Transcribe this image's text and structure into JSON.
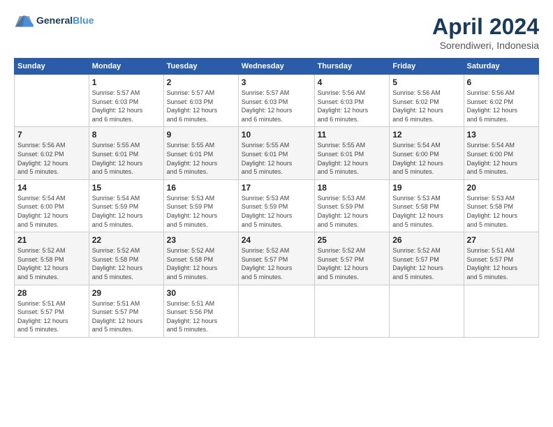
{
  "logo": {
    "text_general": "General",
    "text_blue": "Blue"
  },
  "title": "April 2024",
  "location": "Sorendiweri, Indonesia",
  "days_of_week": [
    "Sunday",
    "Monday",
    "Tuesday",
    "Wednesday",
    "Thursday",
    "Friday",
    "Saturday"
  ],
  "weeks": [
    [
      {
        "day": "",
        "info": ""
      },
      {
        "day": "1",
        "info": "Sunrise: 5:57 AM\nSunset: 6:03 PM\nDaylight: 12 hours\nand 6 minutes."
      },
      {
        "day": "2",
        "info": "Sunrise: 5:57 AM\nSunset: 6:03 PM\nDaylight: 12 hours\nand 6 minutes."
      },
      {
        "day": "3",
        "info": "Sunrise: 5:57 AM\nSunset: 6:03 PM\nDaylight: 12 hours\nand 6 minutes."
      },
      {
        "day": "4",
        "info": "Sunrise: 5:56 AM\nSunset: 6:03 PM\nDaylight: 12 hours\nand 6 minutes."
      },
      {
        "day": "5",
        "info": "Sunrise: 5:56 AM\nSunset: 6:02 PM\nDaylight: 12 hours\nand 6 minutes."
      },
      {
        "day": "6",
        "info": "Sunrise: 5:56 AM\nSunset: 6:02 PM\nDaylight: 12 hours\nand 6 minutes."
      }
    ],
    [
      {
        "day": "7",
        "info": "Sunrise: 5:56 AM\nSunset: 6:02 PM\nDaylight: 12 hours\nand 5 minutes."
      },
      {
        "day": "8",
        "info": "Sunrise: 5:55 AM\nSunset: 6:01 PM\nDaylight: 12 hours\nand 5 minutes."
      },
      {
        "day": "9",
        "info": "Sunrise: 5:55 AM\nSunset: 6:01 PM\nDaylight: 12 hours\nand 5 minutes."
      },
      {
        "day": "10",
        "info": "Sunrise: 5:55 AM\nSunset: 6:01 PM\nDaylight: 12 hours\nand 5 minutes."
      },
      {
        "day": "11",
        "info": "Sunrise: 5:55 AM\nSunset: 6:01 PM\nDaylight: 12 hours\nand 5 minutes."
      },
      {
        "day": "12",
        "info": "Sunrise: 5:54 AM\nSunset: 6:00 PM\nDaylight: 12 hours\nand 5 minutes."
      },
      {
        "day": "13",
        "info": "Sunrise: 5:54 AM\nSunset: 6:00 PM\nDaylight: 12 hours\nand 5 minutes."
      }
    ],
    [
      {
        "day": "14",
        "info": "Sunrise: 5:54 AM\nSunset: 6:00 PM\nDaylight: 12 hours\nand 5 minutes."
      },
      {
        "day": "15",
        "info": "Sunrise: 5:54 AM\nSunset: 5:59 PM\nDaylight: 12 hours\nand 5 minutes."
      },
      {
        "day": "16",
        "info": "Sunrise: 5:53 AM\nSunset: 5:59 PM\nDaylight: 12 hours\nand 5 minutes."
      },
      {
        "day": "17",
        "info": "Sunrise: 5:53 AM\nSunset: 5:59 PM\nDaylight: 12 hours\nand 5 minutes."
      },
      {
        "day": "18",
        "info": "Sunrise: 5:53 AM\nSunset: 5:59 PM\nDaylight: 12 hours\nand 5 minutes."
      },
      {
        "day": "19",
        "info": "Sunrise: 5:53 AM\nSunset: 5:58 PM\nDaylight: 12 hours\nand 5 minutes."
      },
      {
        "day": "20",
        "info": "Sunrise: 5:53 AM\nSunset: 5:58 PM\nDaylight: 12 hours\nand 5 minutes."
      }
    ],
    [
      {
        "day": "21",
        "info": "Sunrise: 5:52 AM\nSunset: 5:58 PM\nDaylight: 12 hours\nand 5 minutes."
      },
      {
        "day": "22",
        "info": "Sunrise: 5:52 AM\nSunset: 5:58 PM\nDaylight: 12 hours\nand 5 minutes."
      },
      {
        "day": "23",
        "info": "Sunrise: 5:52 AM\nSunset: 5:58 PM\nDaylight: 12 hours\nand 5 minutes."
      },
      {
        "day": "24",
        "info": "Sunrise: 5:52 AM\nSunset: 5:57 PM\nDaylight: 12 hours\nand 5 minutes."
      },
      {
        "day": "25",
        "info": "Sunrise: 5:52 AM\nSunset: 5:57 PM\nDaylight: 12 hours\nand 5 minutes."
      },
      {
        "day": "26",
        "info": "Sunrise: 5:52 AM\nSunset: 5:57 PM\nDaylight: 12 hours\nand 5 minutes."
      },
      {
        "day": "27",
        "info": "Sunrise: 5:51 AM\nSunset: 5:57 PM\nDaylight: 12 hours\nand 5 minutes."
      }
    ],
    [
      {
        "day": "28",
        "info": "Sunrise: 5:51 AM\nSunset: 5:57 PM\nDaylight: 12 hours\nand 5 minutes."
      },
      {
        "day": "29",
        "info": "Sunrise: 5:51 AM\nSunset: 5:57 PM\nDaylight: 12 hours\nand 5 minutes."
      },
      {
        "day": "30",
        "info": "Sunrise: 5:51 AM\nSunset: 5:56 PM\nDaylight: 12 hours\nand 5 minutes."
      },
      {
        "day": "",
        "info": ""
      },
      {
        "day": "",
        "info": ""
      },
      {
        "day": "",
        "info": ""
      },
      {
        "day": "",
        "info": ""
      }
    ]
  ]
}
